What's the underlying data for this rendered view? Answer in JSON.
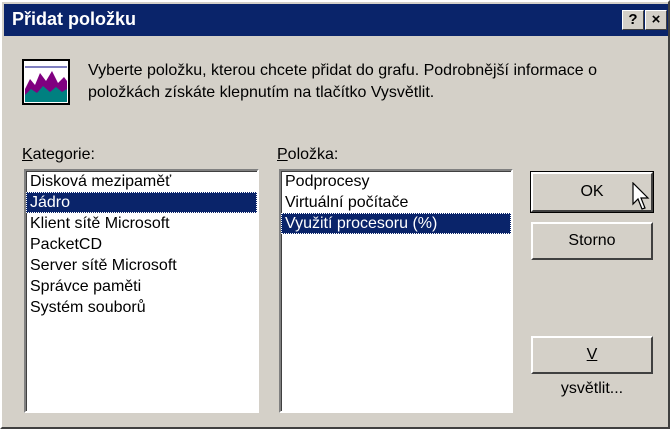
{
  "window": {
    "title": "Přidat položku",
    "help_label": "?",
    "close_label": "×"
  },
  "header": {
    "icon": "performance-chart-icon",
    "instructions": "Vyberte položku, kterou chcete přidat do grafu. Podrobnější informace o položkách získáte klepnutím na tlačítko Vysvětlit."
  },
  "categories": {
    "label_accel": "K",
    "label_rest": "ategorie:",
    "items": [
      "Disková mezipaměť",
      "Jádro",
      "Klient sítě Microsoft",
      "PacketCD",
      "Server sítě Microsoft",
      "Správce paměti",
      "Systém souborů"
    ],
    "selected": "Jádro"
  },
  "items": {
    "label_accel": "P",
    "label_rest": "oložka:",
    "items": [
      "Podprocesy",
      "Virtuální počítače",
      "Využití procesoru (%)"
    ],
    "selected": "Využití procesoru (%)"
  },
  "buttons": {
    "ok": "OK",
    "cancel": "Storno",
    "explain_accel": "V",
    "explain_rest": "ysvětlit..."
  },
  "colors": {
    "titlebar": "#0a246a",
    "selection": "#0a246a",
    "face": "#d4d0c8"
  }
}
